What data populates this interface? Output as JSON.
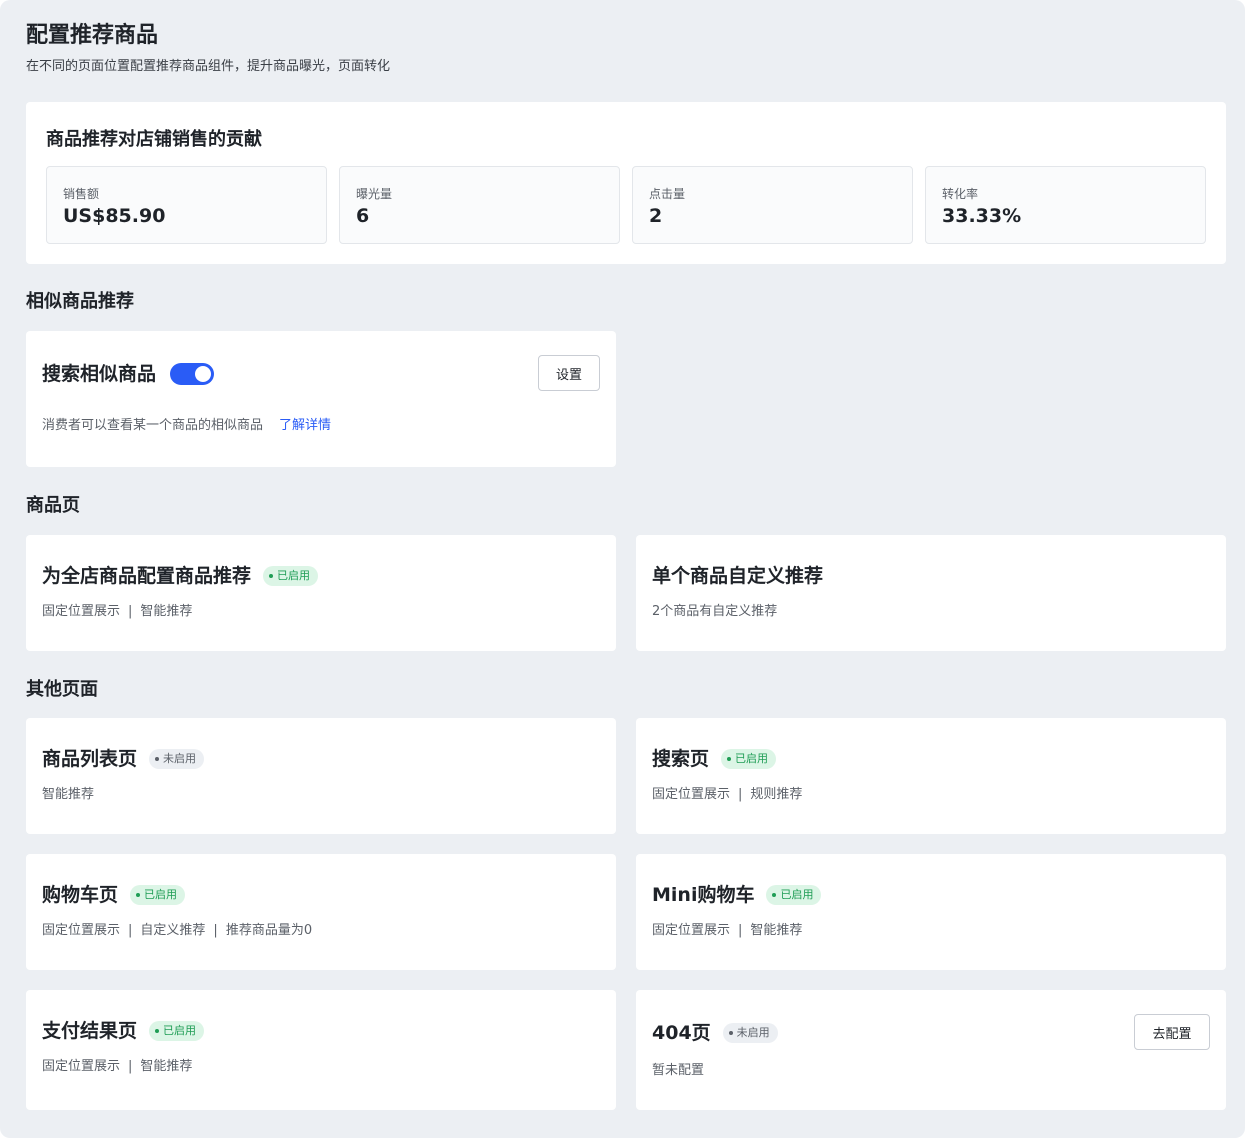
{
  "header": {
    "title": "配置推荐商品",
    "subtitle": "在不同的页面位置配置推荐商品组件，提升商品曝光，页面转化"
  },
  "stats": {
    "title": "商品推荐对店铺销售的贡献",
    "items": [
      {
        "label": "销售额",
        "value": "US$85.90"
      },
      {
        "label": "曝光量",
        "value": "6"
      },
      {
        "label": "点击量",
        "value": "2"
      },
      {
        "label": "转化率",
        "value": "33.33%"
      }
    ]
  },
  "similar": {
    "section_title": "相似商品推荐",
    "card_title": "搜索相似商品",
    "toggle_on": true,
    "settings_button": "设置",
    "desc": "消费者可以查看某一个商品的相似商品",
    "learn_more": "了解详情"
  },
  "product_page": {
    "section_title": "商品页",
    "all_store": {
      "title": "为全店商品配置商品推荐",
      "badge": "已启用",
      "desc1": "固定位置展示",
      "desc2": "智能推荐"
    },
    "single": {
      "title": "单个商品自定义推荐",
      "desc": "2个商品有自定义推荐"
    }
  },
  "other_pages": {
    "section_title": "其他页面",
    "list_page": {
      "title": "商品列表页",
      "badge": "未启用",
      "desc1": "智能推荐"
    },
    "search_page": {
      "title": "搜索页",
      "badge": "已启用",
      "desc1": "固定位置展示",
      "desc2": "规则推荐"
    },
    "cart_page": {
      "title": "购物车页",
      "badge": "已启用",
      "desc1": "固定位置展示",
      "desc2": "自定义推荐",
      "desc3": "推荐商品量为0"
    },
    "mini_cart": {
      "title": "Mini购物车",
      "badge": "已启用",
      "desc1": "固定位置展示",
      "desc2": "智能推荐"
    },
    "payment_page": {
      "title": "支付结果页",
      "badge": "已启用",
      "desc1": "固定位置展示",
      "desc2": "智能推荐"
    },
    "page_404": {
      "title": "404页",
      "badge": "未启用",
      "desc1": "暂未配置",
      "configure_button": "去配置"
    }
  },
  "separator": "|",
  "colors": {
    "accent": "#2a5cf6",
    "enabled_bg": "#dcf5e6",
    "enabled_text": "#1f9d55",
    "disabled_bg": "#eceff3",
    "page_bg": "#eceff3"
  }
}
